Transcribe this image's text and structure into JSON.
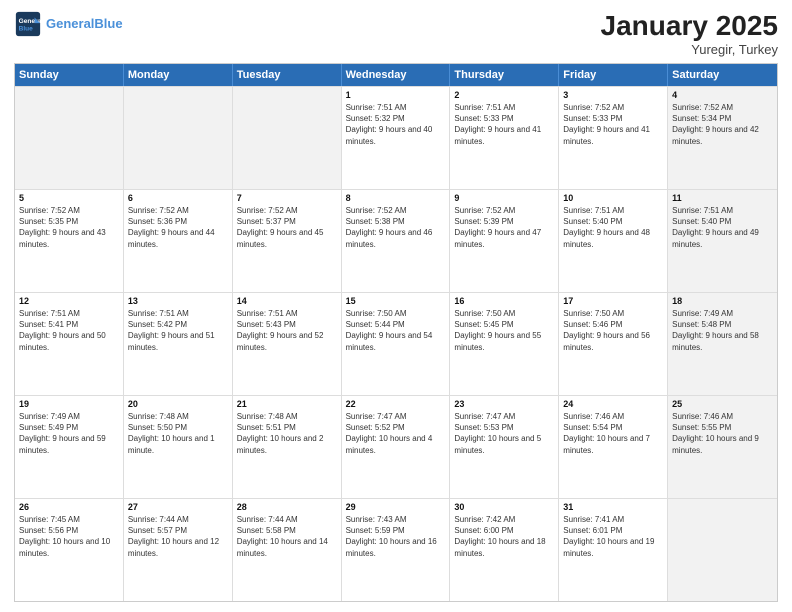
{
  "header": {
    "logo_line1": "General",
    "logo_line2": "Blue",
    "title": "January 2025",
    "subtitle": "Yuregir, Turkey"
  },
  "days_of_week": [
    "Sunday",
    "Monday",
    "Tuesday",
    "Wednesday",
    "Thursday",
    "Friday",
    "Saturday"
  ],
  "weeks": [
    [
      {
        "day": "",
        "info": "",
        "shaded": true
      },
      {
        "day": "",
        "info": "",
        "shaded": true
      },
      {
        "day": "",
        "info": "",
        "shaded": true
      },
      {
        "day": "1",
        "info": "Sunrise: 7:51 AM\nSunset: 5:32 PM\nDaylight: 9 hours and 40 minutes.",
        "shaded": false
      },
      {
        "day": "2",
        "info": "Sunrise: 7:51 AM\nSunset: 5:33 PM\nDaylight: 9 hours and 41 minutes.",
        "shaded": false
      },
      {
        "day": "3",
        "info": "Sunrise: 7:52 AM\nSunset: 5:33 PM\nDaylight: 9 hours and 41 minutes.",
        "shaded": false
      },
      {
        "day": "4",
        "info": "Sunrise: 7:52 AM\nSunset: 5:34 PM\nDaylight: 9 hours and 42 minutes.",
        "shaded": true
      }
    ],
    [
      {
        "day": "5",
        "info": "Sunrise: 7:52 AM\nSunset: 5:35 PM\nDaylight: 9 hours and 43 minutes.",
        "shaded": false
      },
      {
        "day": "6",
        "info": "Sunrise: 7:52 AM\nSunset: 5:36 PM\nDaylight: 9 hours and 44 minutes.",
        "shaded": false
      },
      {
        "day": "7",
        "info": "Sunrise: 7:52 AM\nSunset: 5:37 PM\nDaylight: 9 hours and 45 minutes.",
        "shaded": false
      },
      {
        "day": "8",
        "info": "Sunrise: 7:52 AM\nSunset: 5:38 PM\nDaylight: 9 hours and 46 minutes.",
        "shaded": false
      },
      {
        "day": "9",
        "info": "Sunrise: 7:52 AM\nSunset: 5:39 PM\nDaylight: 9 hours and 47 minutes.",
        "shaded": false
      },
      {
        "day": "10",
        "info": "Sunrise: 7:51 AM\nSunset: 5:40 PM\nDaylight: 9 hours and 48 minutes.",
        "shaded": false
      },
      {
        "day": "11",
        "info": "Sunrise: 7:51 AM\nSunset: 5:40 PM\nDaylight: 9 hours and 49 minutes.",
        "shaded": true
      }
    ],
    [
      {
        "day": "12",
        "info": "Sunrise: 7:51 AM\nSunset: 5:41 PM\nDaylight: 9 hours and 50 minutes.",
        "shaded": false
      },
      {
        "day": "13",
        "info": "Sunrise: 7:51 AM\nSunset: 5:42 PM\nDaylight: 9 hours and 51 minutes.",
        "shaded": false
      },
      {
        "day": "14",
        "info": "Sunrise: 7:51 AM\nSunset: 5:43 PM\nDaylight: 9 hours and 52 minutes.",
        "shaded": false
      },
      {
        "day": "15",
        "info": "Sunrise: 7:50 AM\nSunset: 5:44 PM\nDaylight: 9 hours and 54 minutes.",
        "shaded": false
      },
      {
        "day": "16",
        "info": "Sunrise: 7:50 AM\nSunset: 5:45 PM\nDaylight: 9 hours and 55 minutes.",
        "shaded": false
      },
      {
        "day": "17",
        "info": "Sunrise: 7:50 AM\nSunset: 5:46 PM\nDaylight: 9 hours and 56 minutes.",
        "shaded": false
      },
      {
        "day": "18",
        "info": "Sunrise: 7:49 AM\nSunset: 5:48 PM\nDaylight: 9 hours and 58 minutes.",
        "shaded": true
      }
    ],
    [
      {
        "day": "19",
        "info": "Sunrise: 7:49 AM\nSunset: 5:49 PM\nDaylight: 9 hours and 59 minutes.",
        "shaded": false
      },
      {
        "day": "20",
        "info": "Sunrise: 7:48 AM\nSunset: 5:50 PM\nDaylight: 10 hours and 1 minute.",
        "shaded": false
      },
      {
        "day": "21",
        "info": "Sunrise: 7:48 AM\nSunset: 5:51 PM\nDaylight: 10 hours and 2 minutes.",
        "shaded": false
      },
      {
        "day": "22",
        "info": "Sunrise: 7:47 AM\nSunset: 5:52 PM\nDaylight: 10 hours and 4 minutes.",
        "shaded": false
      },
      {
        "day": "23",
        "info": "Sunrise: 7:47 AM\nSunset: 5:53 PM\nDaylight: 10 hours and 5 minutes.",
        "shaded": false
      },
      {
        "day": "24",
        "info": "Sunrise: 7:46 AM\nSunset: 5:54 PM\nDaylight: 10 hours and 7 minutes.",
        "shaded": false
      },
      {
        "day": "25",
        "info": "Sunrise: 7:46 AM\nSunset: 5:55 PM\nDaylight: 10 hours and 9 minutes.",
        "shaded": true
      }
    ],
    [
      {
        "day": "26",
        "info": "Sunrise: 7:45 AM\nSunset: 5:56 PM\nDaylight: 10 hours and 10 minutes.",
        "shaded": false
      },
      {
        "day": "27",
        "info": "Sunrise: 7:44 AM\nSunset: 5:57 PM\nDaylight: 10 hours and 12 minutes.",
        "shaded": false
      },
      {
        "day": "28",
        "info": "Sunrise: 7:44 AM\nSunset: 5:58 PM\nDaylight: 10 hours and 14 minutes.",
        "shaded": false
      },
      {
        "day": "29",
        "info": "Sunrise: 7:43 AM\nSunset: 5:59 PM\nDaylight: 10 hours and 16 minutes.",
        "shaded": false
      },
      {
        "day": "30",
        "info": "Sunrise: 7:42 AM\nSunset: 6:00 PM\nDaylight: 10 hours and 18 minutes.",
        "shaded": false
      },
      {
        "day": "31",
        "info": "Sunrise: 7:41 AM\nSunset: 6:01 PM\nDaylight: 10 hours and 19 minutes.",
        "shaded": false
      },
      {
        "day": "",
        "info": "",
        "shaded": true
      }
    ]
  ]
}
